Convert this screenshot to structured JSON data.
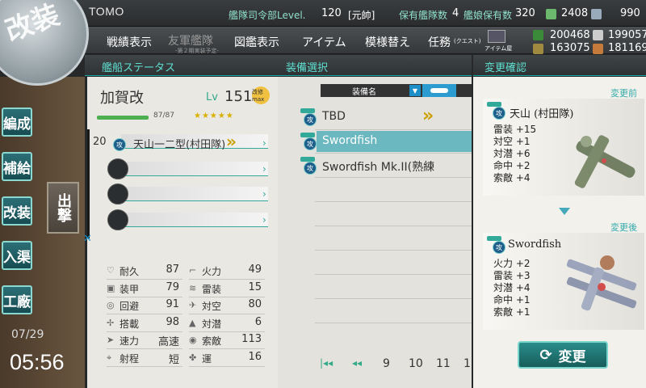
{
  "header": {
    "admiral_name": "TOMO",
    "hq_label": "艦隊司令部Level.",
    "hq_level": "120",
    "rank": "[元帥]",
    "ships_label": "保有艦隊数",
    "ships_count": "4",
    "shipgirls_label": "艦娘保有数",
    "shipgirls_count": "320",
    "bucket": "2408",
    "devmat": "990",
    "fuel": "200468",
    "steel": "199057",
    "ammo": "163075",
    "bauxite": "181169"
  },
  "menu": {
    "record": "戦績表示",
    "friend_fleet": "友軍艦隊",
    "friend_sub": "-第２期実装予定-",
    "library": "図鑑表示",
    "items": "アイテム",
    "furniture": "模様替え",
    "quest": "任務",
    "quest_sub": "(クエスト)",
    "item_shop": "アイテム屋"
  },
  "sections": {
    "ship_status": "艦船ステータス",
    "equip_select": "装備選択",
    "confirm": "変更確認"
  },
  "nav": {
    "logo": "改装",
    "organize": "編成",
    "supply": "補給",
    "remodel": "改装",
    "dock": "入渠",
    "factory": "工廠",
    "sortie": "出撃",
    "date": "07/29",
    "time": "05:56"
  },
  "ship": {
    "name": "加賀改",
    "lv_label": "Lv",
    "level": "151",
    "remodel_badge": "改修max",
    "hp": "87/87",
    "stars": "★★★★★",
    "slot1_count": "20",
    "slot1_name": "天山一二型(村田隊)",
    "stats": [
      {
        "name": "耐久",
        "value": "87",
        "icon": "heart-icon"
      },
      {
        "name": "火力",
        "value": "49",
        "icon": "cannon-icon"
      },
      {
        "name": "装甲",
        "value": "79",
        "icon": "armor-icon"
      },
      {
        "name": "雷装",
        "value": "15",
        "icon": "torpedo-icon"
      },
      {
        "name": "回避",
        "value": "91",
        "icon": "evasion-icon"
      },
      {
        "name": "対空",
        "value": "80",
        "icon": "antiair-icon"
      },
      {
        "name": "搭載",
        "value": "98",
        "icon": "aircraft-icon"
      },
      {
        "name": "対潜",
        "value": "6",
        "icon": "asw-icon"
      },
      {
        "name": "速力",
        "value": "高速",
        "icon": "speed-icon"
      },
      {
        "name": "索敵",
        "value": "113",
        "icon": "eye-icon"
      },
      {
        "name": "射程",
        "value": "短",
        "icon": "range-icon"
      },
      {
        "name": "運",
        "value": "16",
        "icon": "clover-icon"
      }
    ]
  },
  "equip_list": {
    "header_label": "装備名",
    "items": [
      {
        "name": "TBD",
        "badge": "攻"
      },
      {
        "name": "Swordfish",
        "badge": "攻"
      },
      {
        "name": "Swordfish Mk.II(熟練",
        "badge": "攻"
      }
    ],
    "pages": [
      "9",
      "10",
      "11",
      "1"
    ]
  },
  "confirm": {
    "before_label": "変更前",
    "after_label": "変更後",
    "before": {
      "name": "天山 (村田隊)",
      "badge": "攻",
      "stats": [
        "雷装 +15",
        "対空 +1",
        "対潜 +6",
        "命中 +2",
        "索敵 +4"
      ]
    },
    "after": {
      "name": "Swordfish",
      "badge": "攻",
      "stats": [
        "火力 +2",
        "雷装 +3",
        "対潜 +4",
        "命中 +1",
        "索敵 +1"
      ]
    },
    "change_button": "変更"
  }
}
